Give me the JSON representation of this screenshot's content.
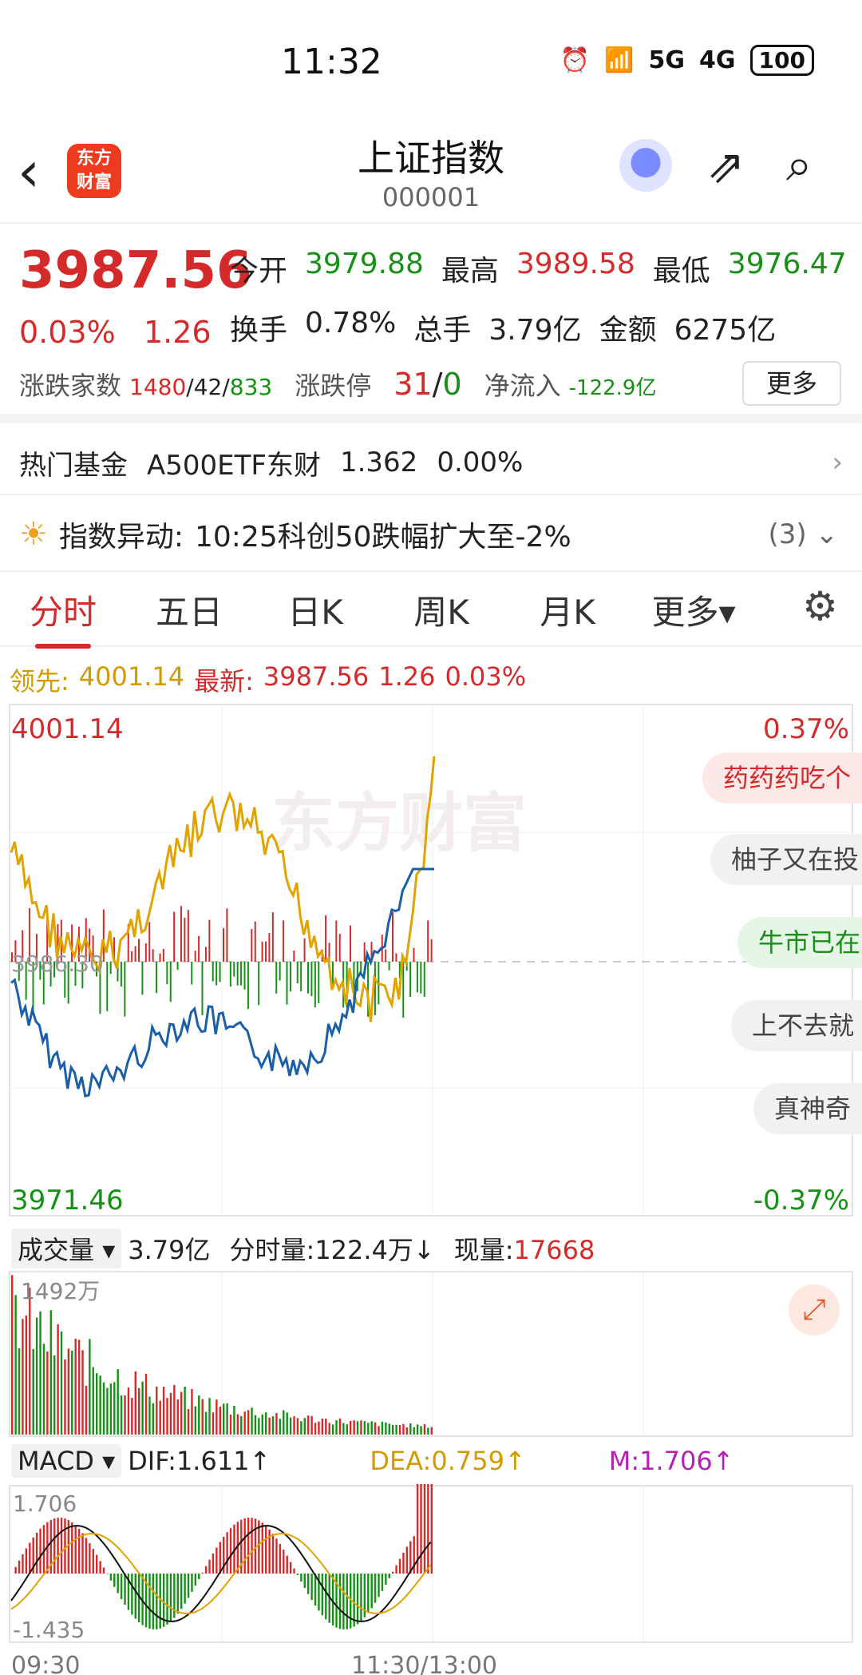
{
  "status_bar": {
    "time": "11:32",
    "net1": "5G",
    "net2": "4G",
    "battery": "100"
  },
  "header": {
    "app_logo": "东方\n财富",
    "title": "上证指数",
    "code": "000001"
  },
  "quote": {
    "price": "3987.56",
    "pct": "0.03%",
    "chg": "1.26",
    "open_label": "今开",
    "open": "3979.88",
    "high_label": "最高",
    "high": "3989.58",
    "low_label": "最低",
    "low": "3976.47",
    "turnover_label": "换手",
    "turnover": "0.78%",
    "vol_label": "总手",
    "vol": "3.79亿",
    "amt_label": "金额",
    "amt": "6275亿",
    "updown_label": "涨跌家数",
    "up": "1480",
    "flat": "42",
    "down": "833",
    "limit_label": "涨跌停",
    "limit_up": "31",
    "limit_down": "0",
    "inflow_label": "净流入",
    "inflow": "-122.9亿",
    "more": "更多"
  },
  "fund": {
    "label": "热门基金",
    "name": "A500ETF东财",
    "value": "1.362",
    "pct": "0.00%"
  },
  "alert": {
    "label": "指数异动:",
    "text": "10:25科创50跌幅扩大至-2%",
    "count": "(3)"
  },
  "tabs": [
    "分时",
    "五日",
    "日K",
    "周K",
    "月K",
    "更多▾"
  ],
  "lead_row": {
    "lead_label": "领先:",
    "lead": "4001.14",
    "latest_label": "最新:",
    "latest": "3987.56",
    "chg": "1.26",
    "pct": "0.03%"
  },
  "intraday": {
    "top": "4001.14",
    "top_pct": "0.37%",
    "bottom": "3971.46",
    "bottom_pct": "-0.37%",
    "mid": "3986.30",
    "watermark": "东方财富",
    "comments": [
      "药药药吃个",
      "柚子又在投",
      "牛市已在",
      "上不去就",
      "真神奇"
    ]
  },
  "volume": {
    "label": "成交量",
    "total": "3.79亿",
    "minute_label": "分时量:",
    "minute": "122.4万↓",
    "now_label": "现量:",
    "now": "17668",
    "max": "1492万"
  },
  "macd": {
    "label": "MACD",
    "dif": "DIF:1.611↑",
    "dea": "DEA:0.759↑",
    "m": "M:1.706↑",
    "top": "1.706",
    "bottom": "-1.435"
  },
  "xaxis": {
    "start": "09:30",
    "mid": "11:30/13:00"
  },
  "colors": {
    "red": "#d42a2a",
    "green": "#169016",
    "gold": "#d39a00",
    "blue": "#1a5fa8"
  }
}
